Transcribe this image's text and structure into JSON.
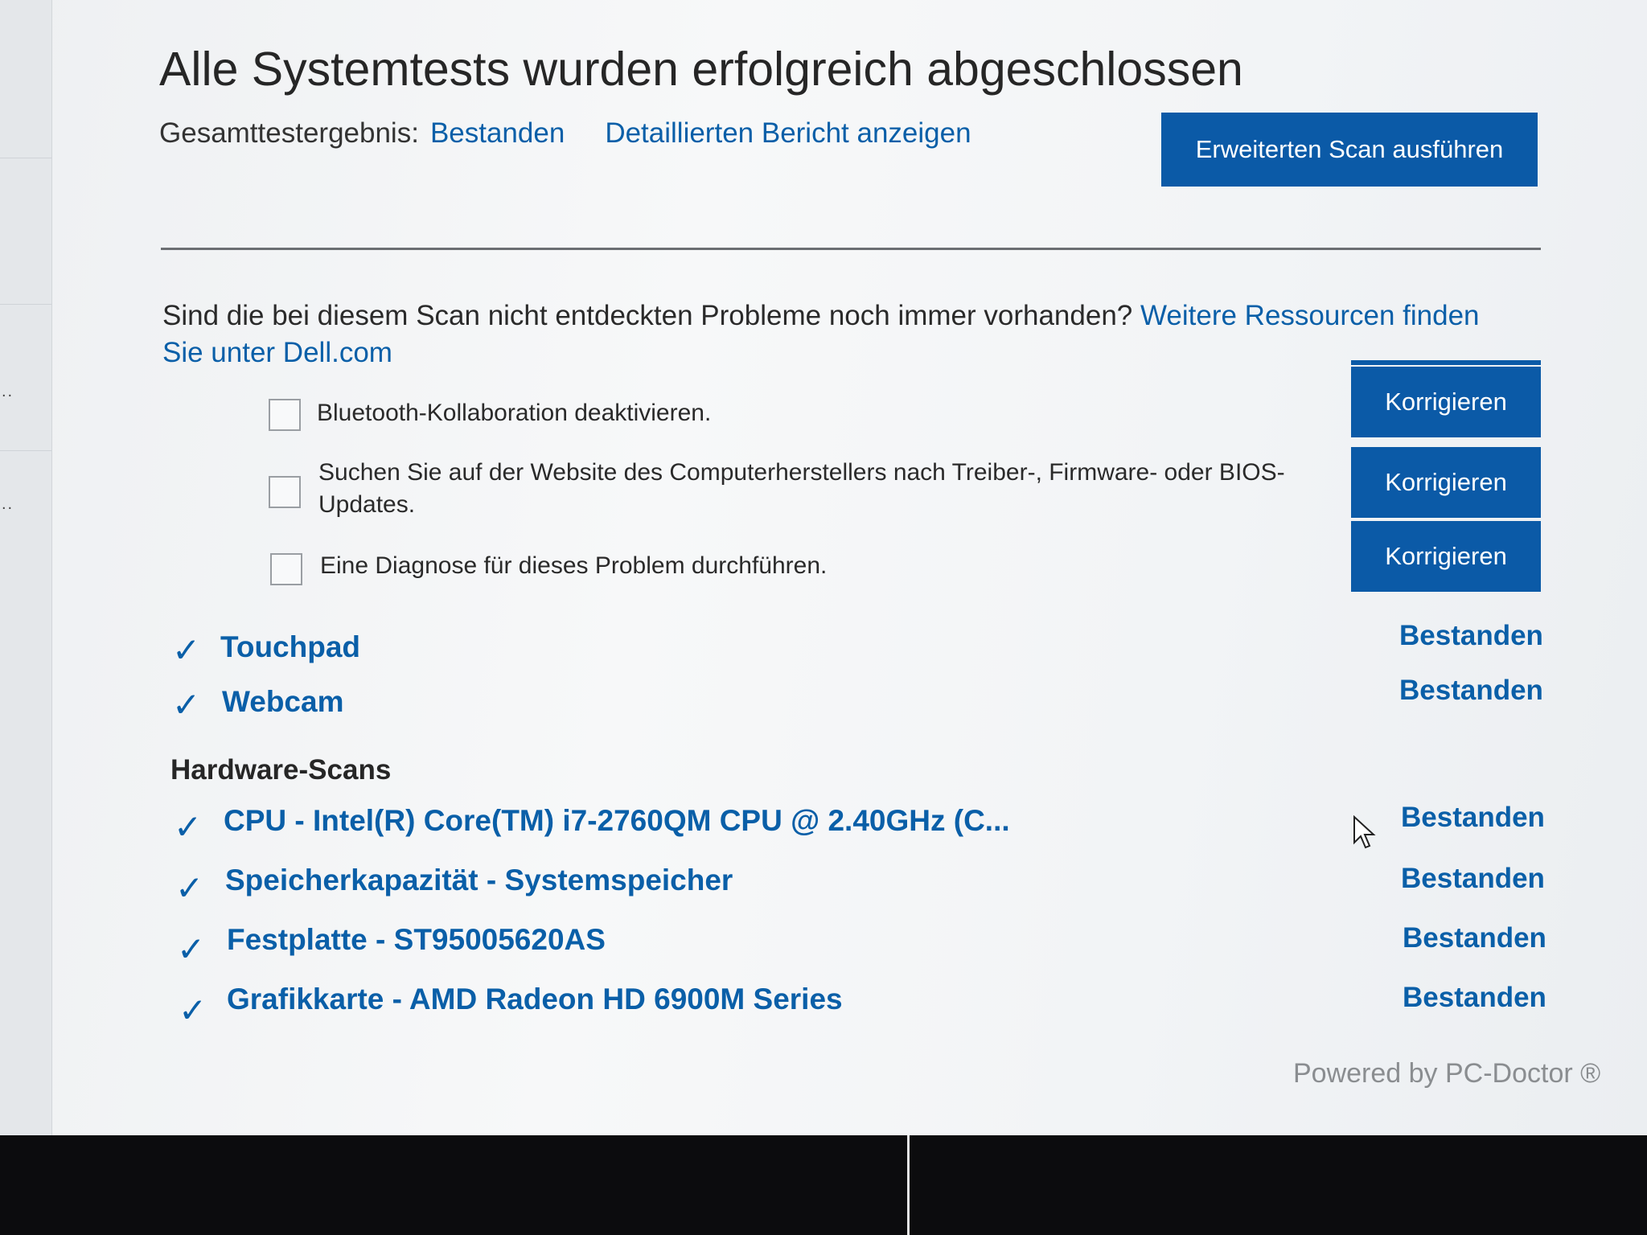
{
  "title": "Alle Systemtests wurden erfolgreich abgeschlossen",
  "summary": {
    "label": "Gesamttestergebnis:",
    "result": "Bestanden",
    "report_link": "Detaillierten Bericht anzeigen"
  },
  "advanced_scan_button": "Erweiterten Scan ausführen",
  "question": {
    "text": "Sind die bei diesem Scan nicht entdeckten Probleme noch immer vorhanden? ",
    "link": "Weitere Ressourcen finden Sie unter Dell.com"
  },
  "fixes": [
    {
      "text": "Bluetooth-Kollaboration deaktivieren.",
      "button": "Korrigieren",
      "checked": false
    },
    {
      "text": "Suchen Sie auf der Website des Computerherstellers nach Treiber-, Firmware- oder BIOS-Updates.",
      "button": "Korrigieren",
      "checked": false
    },
    {
      "text": "Eine Diagnose für dieses Problem durchführen.",
      "button": "Korrigieren",
      "checked": false
    }
  ],
  "tests": [
    {
      "name": "Touchpad",
      "status": "Bestanden"
    },
    {
      "name": "Webcam",
      "status": "Bestanden"
    }
  ],
  "hardware_heading": "Hardware-Scans",
  "hardware": [
    {
      "name": "CPU - Intel(R) Core(TM) i7-2760QM CPU @ 2.40GHz (C...",
      "status": "Bestanden"
    },
    {
      "name": "Speicherkapazität - Systemspeicher",
      "status": "Bestanden"
    },
    {
      "name": "Festplatte - ST95005620AS",
      "status": "Bestanden"
    },
    {
      "name": "Grafikkarte - AMD Radeon HD 6900M Series",
      "status": "Bestanden"
    }
  ],
  "check_glyph": "✓",
  "footer": "Powered by PC-Doctor ®",
  "colors": {
    "accent": "#0b5aa7",
    "link": "#0a5fa8",
    "text": "#262626"
  }
}
